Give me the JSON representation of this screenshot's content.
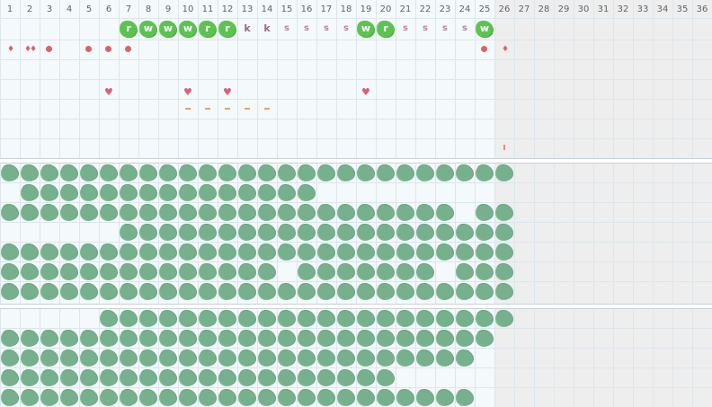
{
  "columns": [
    "1",
    "2",
    "3",
    "4",
    "5",
    "6",
    "7",
    "8",
    "9",
    "10",
    "11",
    "12",
    "13",
    "14",
    "15",
    "16",
    "17",
    "18",
    "19",
    "20",
    "21",
    "22",
    "23",
    "24",
    "25",
    "26",
    "27",
    "28",
    "29",
    "30",
    "31",
    "32",
    "33",
    "34",
    "35",
    "36"
  ],
  "current_column": 26,
  "colors": {
    "grid_bg": "#f4f9fb",
    "shaded_bg": "#eeeeee",
    "grid_line": "#dde6ec",
    "badge_green": "#5cc350",
    "blob_green": "#76b08c",
    "marker_red": "#e06068",
    "heart_pink": "#d9607a",
    "dash_orange": "#f0a060"
  },
  "status_row": [
    {
      "col": 7,
      "kind": "badge",
      "text": "r"
    },
    {
      "col": 8,
      "kind": "badge",
      "text": "w"
    },
    {
      "col": 9,
      "kind": "badge",
      "text": "w"
    },
    {
      "col": 10,
      "kind": "badge",
      "text": "w"
    },
    {
      "col": 11,
      "kind": "badge",
      "text": "r"
    },
    {
      "col": 12,
      "kind": "badge",
      "text": "r"
    },
    {
      "col": 13,
      "kind": "letter",
      "text": "k"
    },
    {
      "col": 14,
      "kind": "letter",
      "text": "k"
    },
    {
      "col": 15,
      "kind": "letter",
      "text": "s"
    },
    {
      "col": 16,
      "kind": "letter",
      "text": "s"
    },
    {
      "col": 17,
      "kind": "letter",
      "text": "s"
    },
    {
      "col": 18,
      "kind": "letter",
      "text": "s"
    },
    {
      "col": 19,
      "kind": "badge",
      "text": "w"
    },
    {
      "col": 20,
      "kind": "badge",
      "text": "r"
    },
    {
      "col": 21,
      "kind": "letter",
      "text": "s"
    },
    {
      "col": 22,
      "kind": "letter",
      "text": "s"
    },
    {
      "col": 23,
      "kind": "letter",
      "text": "s"
    },
    {
      "col": 24,
      "kind": "letter",
      "text": "s"
    },
    {
      "col": 25,
      "kind": "badge",
      "text": "w"
    }
  ],
  "marker_row": [
    {
      "col": 1,
      "kind": "drop",
      "count": 1
    },
    {
      "col": 2,
      "kind": "drop",
      "count": 2
    },
    {
      "col": 3,
      "kind": "dot"
    },
    {
      "col": 5,
      "kind": "dot"
    },
    {
      "col": 6,
      "kind": "dot"
    },
    {
      "col": 7,
      "kind": "dot"
    },
    {
      "col": 25,
      "kind": "dot"
    },
    {
      "col": 26,
      "kind": "drop",
      "count": 1
    }
  ],
  "heart_cols": [
    6,
    10,
    12,
    19
  ],
  "dash_cols": [
    10,
    11,
    12,
    13,
    14
  ],
  "tick_cols": [
    26
  ],
  "blob_section_1": [
    [
      1,
      26
    ],
    [
      2,
      16
    ],
    [
      1,
      23,
      25,
      26
    ],
    [
      7,
      26
    ],
    [
      1,
      26
    ],
    [
      1,
      14,
      16,
      22,
      24,
      26
    ],
    [
      1,
      26
    ]
  ],
  "blob_section_2": [
    [
      6,
      26
    ],
    [
      1,
      25
    ],
    [
      1,
      24
    ],
    [
      1,
      20
    ],
    [
      1,
      24
    ]
  ]
}
